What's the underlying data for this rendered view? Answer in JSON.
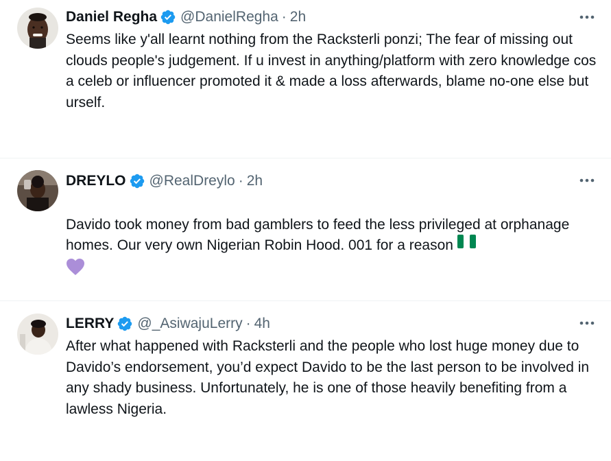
{
  "tweets": [
    {
      "display_name": "Daniel Regha",
      "handle": "@DanielRegha",
      "separator": "·",
      "time": "2h",
      "text": "Seems like y'all learnt nothing from the Racksterli ponzi; The fear of missing out clouds people's judgement. If u invest in anything/platform with zero knowledge cos a celeb or influencer promoted it & made a loss afterwards, blame no-one else but urself.",
      "verified": true,
      "avatar_icon": "avatar-daniel-regha"
    },
    {
      "display_name": "DREYLO",
      "handle": "@RealDreylo",
      "separator": "·",
      "time": "2h",
      "text": "Davido took money from bad gamblers to feed the less privileged at orphanage homes. Our very own Nigerian Robin Hood. 001 for a reason",
      "emojis": [
        "nigeria-flag-icon",
        "purple-heart-icon"
      ],
      "verified": true,
      "avatar_icon": "avatar-dreylo"
    },
    {
      "display_name": "LERRY",
      "handle": "@_AsiwajuLerry",
      "separator": "·",
      "time": "4h",
      "text": "After what happened with Racksterli and the people who lost huge money due to Davido’s endorsement, you’d expect  Davido to be the last person to be involved in any shady business. Unfortunately, he is one of those heavily benefiting from a lawless Nigeria.",
      "verified": true,
      "avatar_icon": "avatar-lerry"
    }
  ],
  "colors": {
    "text": "#0f1419",
    "secondary": "#536471",
    "verified": "#1d9bf0",
    "divider": "#eff3f4",
    "flag_green": "#008751",
    "heart": "#ab8ed8"
  },
  "icons": {
    "more": "more-options-icon",
    "verified": "verified-badge-icon"
  }
}
